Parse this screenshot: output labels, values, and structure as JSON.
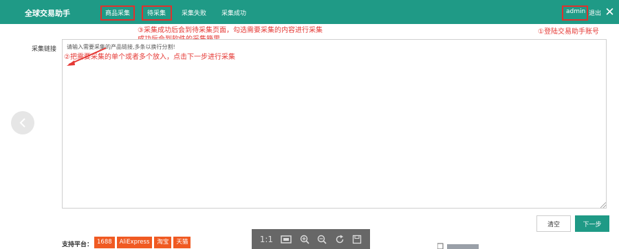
{
  "header": {
    "app_title": "全球交易助手",
    "nav": [
      "商品采集",
      "待采集",
      "采集失败",
      "采集成功"
    ],
    "user": "admin",
    "logout": "退出",
    "close": "✕"
  },
  "notes": {
    "step1": "①登陆交易助手账号",
    "step2": "②把需要采集的单个或者多个放入，点击下一步进行采集",
    "step3_line1": "③采集成功后会到待采集页面，勾选需要采集的内容进行采集",
    "step3_line2": "成功后会到软件的采集箱里"
  },
  "form": {
    "label": "采集链接",
    "placeholder": "请输入需要采集的产品链接,多条以换行分割!"
  },
  "buttons": {
    "clear": "清空",
    "next": "下一步"
  },
  "platforms": {
    "label": "支持平台：",
    "items": [
      "1688",
      "AliExpress",
      "淘宝",
      "天猫"
    ]
  },
  "viewer": {
    "actual_size": "1:1"
  },
  "colors": {
    "header": "#1f9a86",
    "note_red": "#e53935",
    "platform_tag": "#f05a22"
  },
  "icons": [
    "close-icon",
    "chevron-left-icon",
    "fit-screen-icon",
    "zoom-in-icon",
    "zoom-out-icon",
    "rotate-icon",
    "save-icon"
  ]
}
